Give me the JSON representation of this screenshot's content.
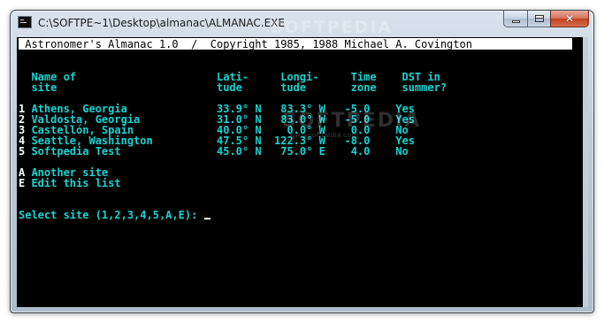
{
  "window": {
    "title": "C:\\SOFTPE~1\\Desktop\\almanac\\ALMANAC.EXE",
    "minimize_icon": "minimize-icon",
    "maximize_icon": "maximize-icon",
    "close_icon": "close-icon",
    "close_glyph": "✕"
  },
  "console": {
    "header": " Astronomer's Almanac 1.0  /  Copyright 1985, 1988 Michael A. Covington",
    "col_header_1": "  Name of                      Lati-     Longi-     Time    DST in",
    "col_header_2": "  site                         tude      tude       zone    summer?",
    "sites": [
      {
        "key": "1",
        "line": " Athens, Georgia              33.9° N   83.3° W   -5.0    Yes"
      },
      {
        "key": "2",
        "line": " Valdosta, Georgia            31.0° N   83.0° W   -5.0    Yes"
      },
      {
        "key": "3",
        "line": " Castellón, Spain             40.0° N    0.0° W    0.0    No"
      },
      {
        "key": "4",
        "line": " Seattle, Washington          47.5° N  122.3° W   -8.0    Yes"
      },
      {
        "key": "5",
        "line": " Softpedia Test               45.0° N   75.0° E    4.0    No"
      }
    ],
    "options": [
      {
        "key": "A",
        "line": " Another site"
      },
      {
        "key": "E",
        "line": " Edit this list"
      }
    ],
    "prompt": "Select site (1,2,3,4,5,A,E): "
  },
  "watermark": {
    "title_text": "SOFTPEDIA",
    "body_text": "SOFTPEDIA",
    "body_url": "www.softpedia.com"
  },
  "colors": {
    "console_bg": "#000000",
    "console_text": "#17d3d3",
    "header_bg": "#ffffff",
    "header_text": "#000000",
    "close_button": "#c84a2c"
  }
}
